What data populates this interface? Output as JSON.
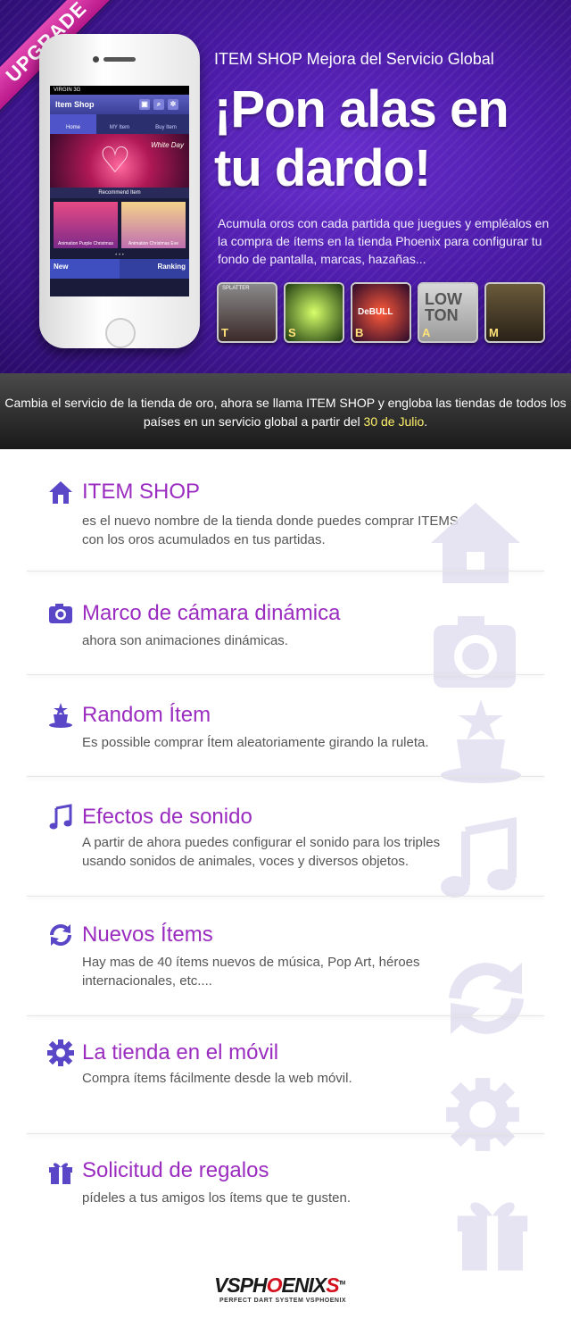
{
  "hero": {
    "ribbon": "UPGRADE",
    "subtitle": "ITEM SHOP Mejora del Servicio Global",
    "title": "¡Pon alas en tu dardo!",
    "description": "Acumula oros con cada partida que juegues y empléalos en la compra de ítems en la tienda Phoenix para configurar tu fondo de pantalla, marcas, hazañas...",
    "tiles": [
      "T",
      "S",
      "B",
      "A",
      "M"
    ],
    "tile_texts": [
      "SPLATTER",
      "",
      "DeBULL",
      "LOW TON",
      ""
    ]
  },
  "phone": {
    "status": "VIRGIN 3G",
    "app_title": "Item Shop",
    "tabs": [
      "Home",
      "MY Item",
      "Buy Item"
    ],
    "banner_text": "White Day",
    "recommend": "Recommend Item",
    "thumbs": [
      "Animation Purple Christmas",
      "Animation Christmas Eve"
    ],
    "bottom_tabs": [
      "New",
      "Ranking"
    ]
  },
  "notice": {
    "text_before": "Cambia el servicio de la tienda de oro, ahora se llama ITEM SHOP y engloba las tiendas de todos los países en un servicio global a partir del ",
    "highlight": "30 de Julio",
    "text_after": "."
  },
  "features": [
    {
      "title": "ITEM SHOP",
      "desc": "es el nuevo nombre de la tienda donde puedes comprar ITEMS con los oros acumulados en tus partidas.",
      "icon": "house-icon"
    },
    {
      "title": "Marco de cámara dinámica",
      "desc": "ahora son animaciones dinámicas.",
      "icon": "camera-icon"
    },
    {
      "title": "Random Ítem",
      "desc": "Es possible comprar Ítem aleatoriamente girando la ruleta.",
      "icon": "magic-hat-icon"
    },
    {
      "title": "Efectos de sonido",
      "desc": "A partir de ahora puedes configurar el sonido para los triples usando sonidos de animales, voces y diversos objetos.",
      "icon": "music-note-icon"
    },
    {
      "title": "Nuevos Ítems",
      "desc": "Hay mas de 40 ítems nuevos de música, Pop Art, héroes internacionales, etc....",
      "icon": "refresh-icon"
    },
    {
      "title": "La tienda en el móvil",
      "desc": "Compra ítems fácilmente desde la web móvil.",
      "icon": "gear-icon"
    },
    {
      "title": "Solicitud de regalos",
      "desc": "pídeles a tus amigos los ítems que te gusten.",
      "icon": "gift-icon"
    }
  ],
  "footer": {
    "logo_part1": "VSPH",
    "logo_part2": "ENIX",
    "logo_o": "O",
    "logo_s": "S",
    "tm": "TM",
    "tagline": "PERFECT DART SYSTEM VSPHOENIX"
  },
  "colors": {
    "title_purple": "#9b2cc0",
    "icon_purple": "#5a47c8",
    "highlight_yellow": "#fff16a",
    "logo_red": "#d4121f"
  }
}
